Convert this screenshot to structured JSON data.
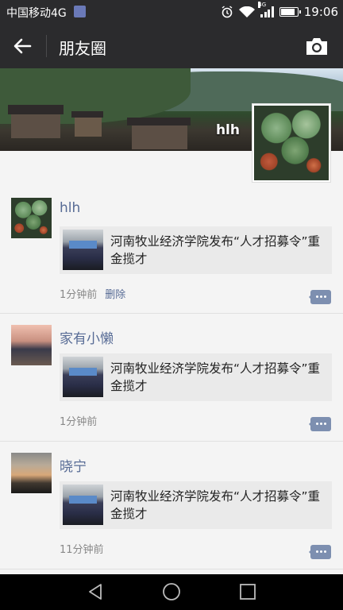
{
  "status_bar": {
    "carrier": "中国移动4G",
    "network_badge": "4G",
    "time": "19:06",
    "icons": [
      "sim-icon",
      "alarm-icon",
      "wifi-icon",
      "signal-icon",
      "battery-icon"
    ]
  },
  "app_bar": {
    "title": "朋友圈",
    "back_icon": "arrow-left-icon",
    "camera_icon": "camera-icon"
  },
  "cover": {
    "user_name": "hlh"
  },
  "posts": [
    {
      "author": "hlh",
      "shared_title": "河南牧业经济学院发布“人才招募令”重金揽才",
      "time": "1分钟前",
      "delete_label": "删除"
    },
    {
      "author": "家有小懒",
      "shared_title": "河南牧业经济学院发布“人才招募令”重金揽才",
      "time": "1分钟前"
    },
    {
      "author": "晓宁",
      "shared_title": "河南牧业经济学院发布“人才招募令”重金揽才",
      "time": "11分钟前"
    }
  ],
  "nav_bar": {
    "icons": [
      "back-triangle-icon",
      "home-circle-icon",
      "recents-square-icon"
    ]
  },
  "colors": {
    "bar_bg": "#2b2b2d",
    "link": "#576b95",
    "feed_bg": "#f4f4f4",
    "card_bg": "#eaeaea"
  }
}
